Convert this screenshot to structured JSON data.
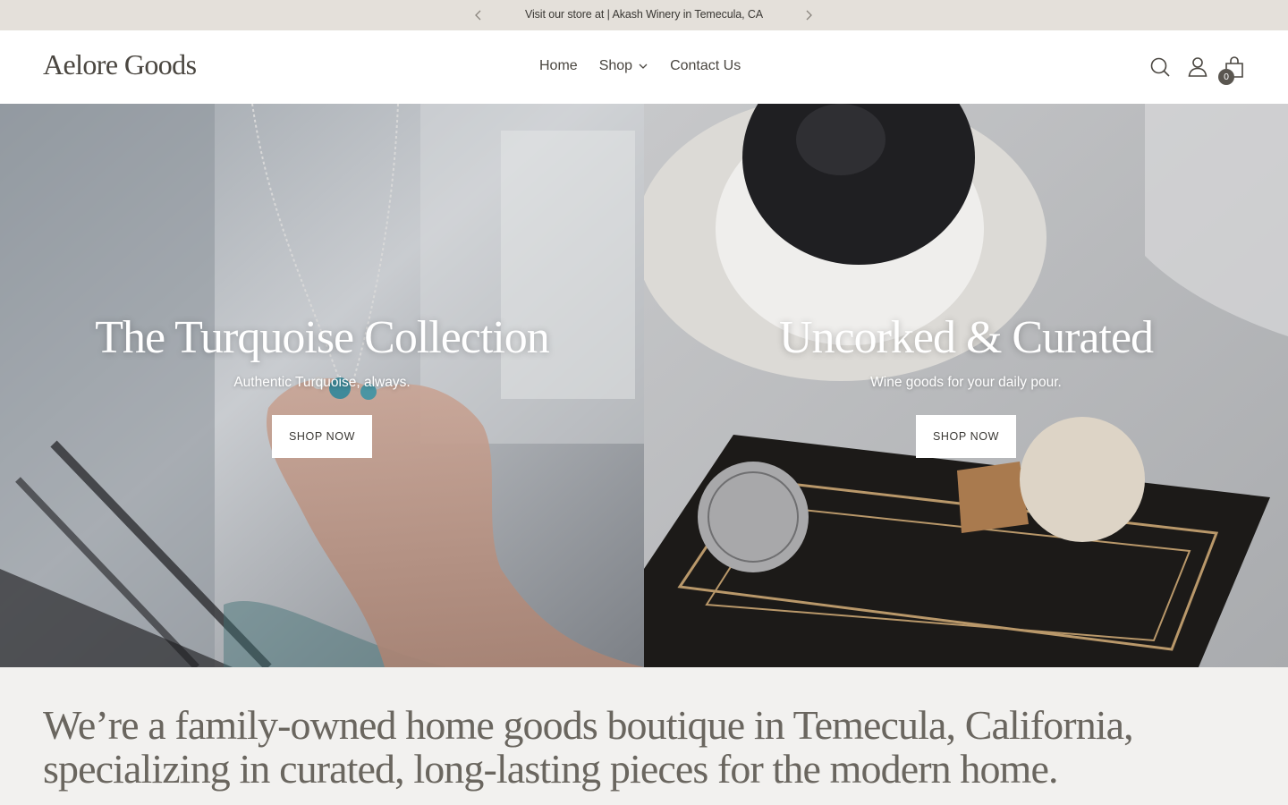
{
  "announcement": {
    "text": "Visit our store at | Akash Winery in Temecula, CA"
  },
  "header": {
    "logo": "Aelore Goods",
    "nav": [
      {
        "label": "Home"
      },
      {
        "label": "Shop"
      },
      {
        "label": "Contact Us"
      }
    ],
    "cart_count": "0"
  },
  "hero": {
    "left": {
      "title": "The Turquoise Collection",
      "subtitle": "Authentic Turquoise, always.",
      "button": "SHOP NOW"
    },
    "right": {
      "title": "Uncorked & Curated",
      "subtitle": "Wine goods for your daily pour.",
      "button": "SHOP NOW"
    }
  },
  "about": {
    "text": "We’re a family-owned home goods boutique in Temecula, California, specializing in curated, long-lasting pieces for the modern home."
  },
  "colors": {
    "announcement_bg": "#e4e0da",
    "header_bg": "#ffffff",
    "page_bg": "#f2f1ef",
    "text_dark": "#4a4640",
    "badge_bg": "#5a5650"
  },
  "icons": [
    "chevron-left-icon",
    "chevron-right-icon",
    "chevron-down-icon",
    "search-icon",
    "account-icon",
    "cart-icon"
  ]
}
